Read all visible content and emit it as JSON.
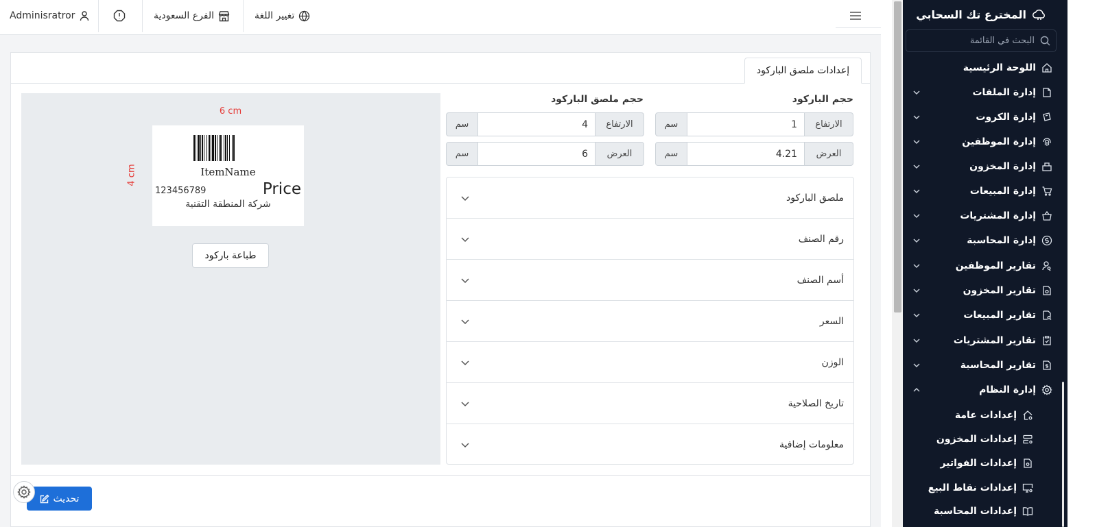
{
  "topbar": {
    "user": "Adminisratror",
    "branch": "الفرع السعودية",
    "language": "تغيير اللغة"
  },
  "tab": {
    "label": "إعدادات ملصق الباركود"
  },
  "preview": {
    "width_label": "6 cm",
    "height_label": "4 cm",
    "item_name": "ItemName",
    "item_code": "123456789",
    "price": "Price",
    "company": "شركة المنطقة التقنية",
    "print_button": "طباعة باركود"
  },
  "barcode_size": {
    "title": "حجم الباركود",
    "height_label": "الارتفاع",
    "height_value": "1",
    "width_label": "العرض",
    "width_value": "4.21",
    "unit": "سم"
  },
  "label_size": {
    "title": "حجم ملصق الباركود",
    "height_label": "الارتفاع",
    "height_value": "4",
    "width_label": "العرض",
    "width_value": "6",
    "unit": "سم"
  },
  "accordion": [
    {
      "label": "ملصق الباركود"
    },
    {
      "label": "رقم الصنف"
    },
    {
      "label": "أسم الصنف"
    },
    {
      "label": "السعر"
    },
    {
      "label": "الوزن"
    },
    {
      "label": "تاريخ الصلاحية"
    },
    {
      "label": "معلومات إضافية"
    }
  ],
  "update_button": "تحديث",
  "sidebar": {
    "brand": "المخترع تك السحابي",
    "search_placeholder": "البحث في القائمة",
    "items": [
      {
        "label": "اللوحة الرئيسية",
        "icon": "home-icon"
      },
      {
        "label": "إدارة الملفات",
        "icon": "files-icon"
      },
      {
        "label": "إدارة الكروت",
        "icon": "cards-icon"
      },
      {
        "label": "إدارة الموظفين",
        "icon": "fingerprint-icon"
      },
      {
        "label": "إدارة المخزون",
        "icon": "inventory-icon"
      },
      {
        "label": "إدارة المبيعات",
        "icon": "cart-icon"
      },
      {
        "label": "إدارة المشتريات",
        "icon": "basket-icon"
      },
      {
        "label": "إدارة المحاسبة",
        "icon": "dollar-icon"
      },
      {
        "label": "تقارير الموظفين",
        "icon": "user-search-icon"
      },
      {
        "label": "تقارير المخزون",
        "icon": "report-icon"
      },
      {
        "label": "تقارير المبيعات",
        "icon": "report-search-icon"
      },
      {
        "label": "تقارير المشتريات",
        "icon": "clipboard-icon"
      },
      {
        "label": "تقارير المحاسبة",
        "icon": "dollar-doc-icon"
      },
      {
        "label": "إدارة النظام",
        "icon": "gear-icon"
      }
    ],
    "sub_items": [
      {
        "label": "إعدادات عامة",
        "icon": "home-gear-icon"
      },
      {
        "label": "إعدادات المخزون",
        "icon": "server-gear-icon"
      },
      {
        "label": "إعدادات الفواتير",
        "icon": "invoice-gear-icon"
      },
      {
        "label": "إعدادات نقاط البيع",
        "icon": "monitor-gear-icon"
      },
      {
        "label": "إعدادات المحاسبة",
        "icon": "book-icon"
      }
    ]
  },
  "colors": {
    "sidebar_bg": "#101828",
    "primary": "#1e6fd9",
    "dimension_red": "#e53935",
    "preview_bg": "#e9ecef"
  }
}
